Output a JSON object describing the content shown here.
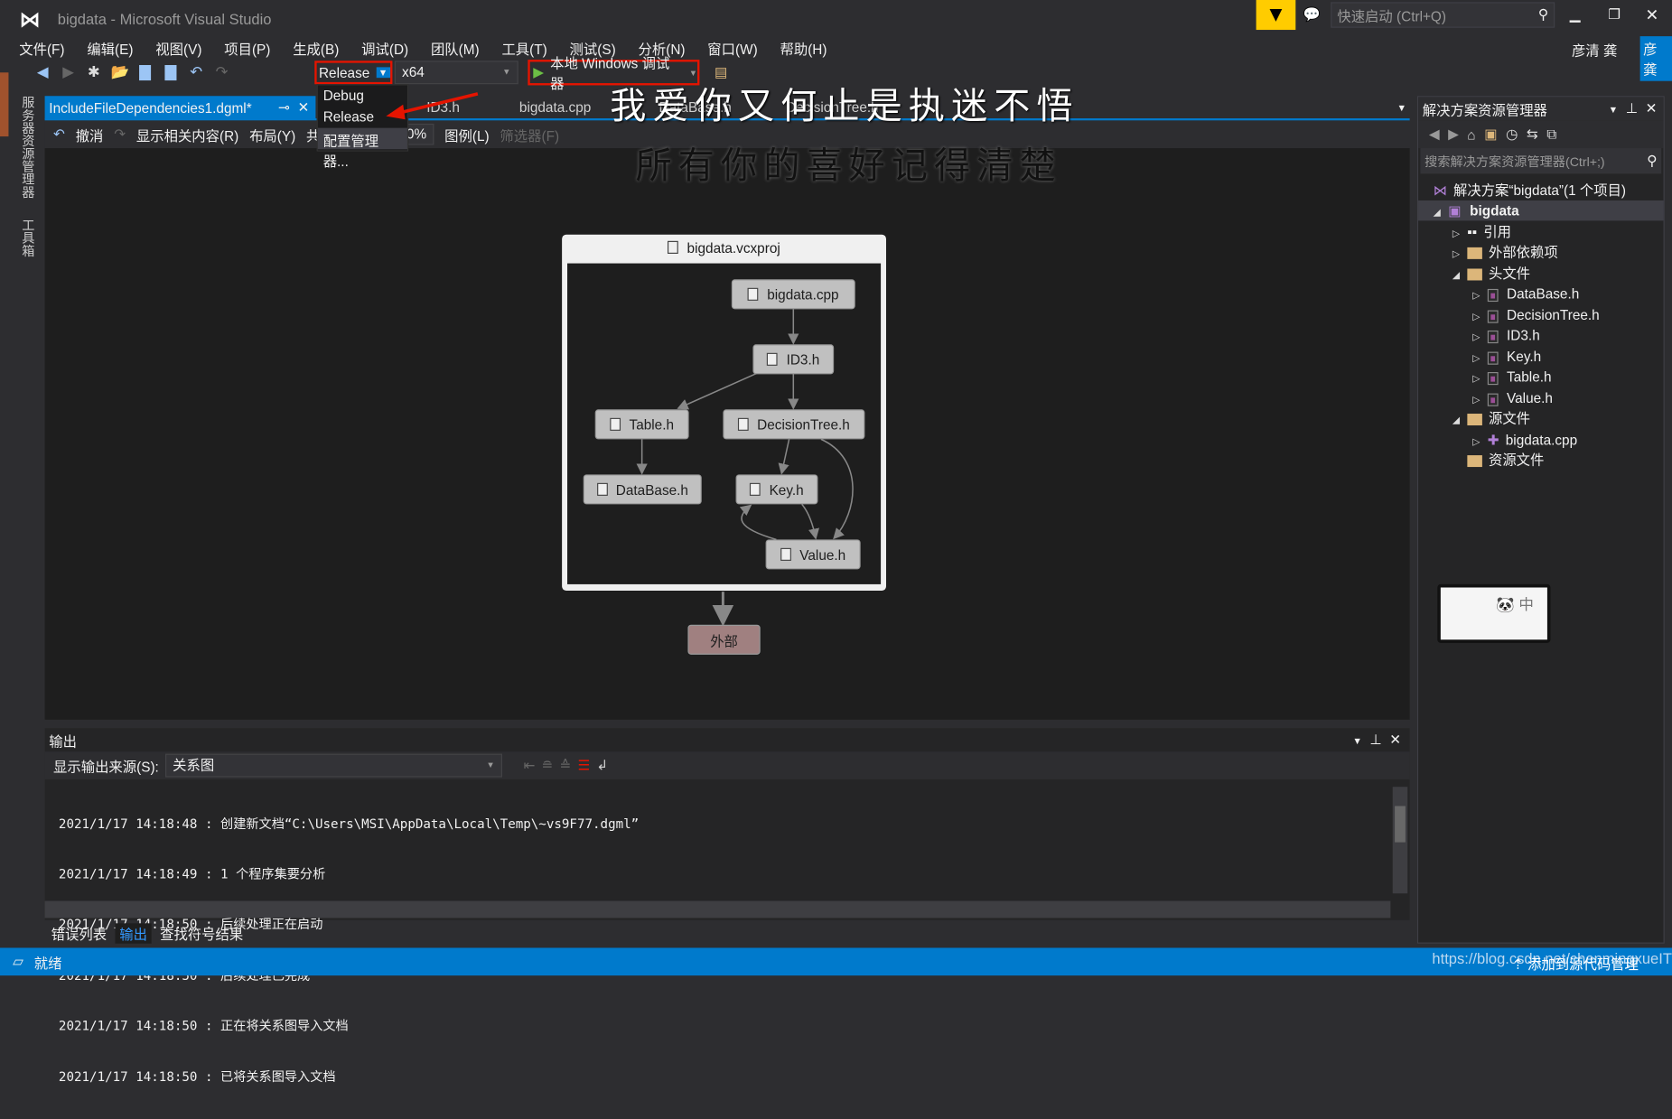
{
  "window": {
    "title": "bigdata - Microsoft Visual Studio",
    "quick_launch_placeholder": "快速启动 (Ctrl+Q)",
    "user_name": "彦清 龚",
    "user_badge": "彦龚"
  },
  "menu": [
    "文件(F)",
    "编辑(E)",
    "视图(V)",
    "项目(P)",
    "生成(B)",
    "调试(D)",
    "团队(M)",
    "工具(T)",
    "测试(S)",
    "分析(N)",
    "窗口(W)",
    "帮助(H)"
  ],
  "toolbar": {
    "configuration": "Release",
    "platform": "x64",
    "debugger": "本地 Windows 调试器"
  },
  "config_dropdown": {
    "options": [
      "Debug",
      "Release",
      "配置管理器..."
    ]
  },
  "left_rail": [
    "服务器资源管理器",
    "工具箱"
  ],
  "tabs": [
    {
      "label": "IncludeFileDependencies1.dgml*",
      "active": true
    },
    {
      "label": "ID3.h"
    },
    {
      "label": "bigdata.cpp"
    },
    {
      "label": "DataBase.h"
    },
    {
      "label": "DecisionTree.h"
    }
  ],
  "dgml_toolbar": {
    "undo": "撤消",
    "show_related": "显示相关内容(R)",
    "layout": "布局(Y)",
    "share": "共享(A)",
    "zoom": "100%",
    "legend": "图例(L)",
    "filters": "筛选器(F)"
  },
  "overlay_text": [
    "我爱你又何止是执迷不悟",
    "所有你的喜好记得清楚"
  ],
  "diagram": {
    "group": "bigdata.vcxproj",
    "nodes": [
      "bigdata.cpp",
      "ID3.h",
      "Table.h",
      "DecisionTree.h",
      "DataBase.h",
      "Key.h",
      "Value.h"
    ],
    "external": "外部",
    "external_color": "#a08080",
    "edges": [
      [
        "bigdata.cpp",
        "ID3.h"
      ],
      [
        "ID3.h",
        "Table.h"
      ],
      [
        "ID3.h",
        "DecisionTree.h"
      ],
      [
        "Table.h",
        "DataBase.h"
      ],
      [
        "DecisionTree.h",
        "Key.h"
      ],
      [
        "DecisionTree.h",
        "Value.h"
      ],
      [
        "Key.h",
        "Value.h"
      ],
      [
        "Value.h",
        "Key.h"
      ],
      [
        "bigdata.vcxproj",
        "外部"
      ]
    ]
  },
  "output": {
    "title": "输出",
    "source_label": "显示输出来源(S):",
    "source_value": "关系图",
    "lines": [
      "2021/1/17 14:18:48 : 创建新文档“C:\\Users\\MSI\\AppData\\Local\\Temp\\~vs9F77.dgml”",
      "2021/1/17 14:18:49 : 1 个程序集要分析",
      "2021/1/17 14:18:50 : 后续处理正在启动",
      "2021/1/17 14:18:50 : 后续处理已完成",
      "2021/1/17 14:18:50 : 正在将关系图导入文档",
      "2021/1/17 14:18:50 : 已将关系图导入文档"
    ]
  },
  "bottom_tabs": [
    {
      "label": "错误列表"
    },
    {
      "label": "输出",
      "active": true
    },
    {
      "label": "查找符号结果"
    }
  ],
  "solution_explorer": {
    "title": "解决方案资源管理器",
    "search_placeholder": "搜索解决方案资源管理器(Ctrl+;)",
    "solution": "解决方案“bigdata”(1 个项目)",
    "project": "bigdata",
    "items": [
      "引用",
      "外部依赖项",
      "头文件",
      "DataBase.h",
      "DecisionTree.h",
      "ID3.h",
      "Key.h",
      "Table.h",
      "Value.h",
      "源文件",
      "bigdata.cpp",
      "资源文件"
    ]
  },
  "status": {
    "text": "就绪",
    "source_control": "添加到源代码管理",
    "watermark": "https://blog.csdn.net/chenmingxueIT"
  },
  "colors": {
    "accent": "#007acc",
    "highlight_box": "#e51400",
    "filter_badge": "#ffcc00"
  }
}
